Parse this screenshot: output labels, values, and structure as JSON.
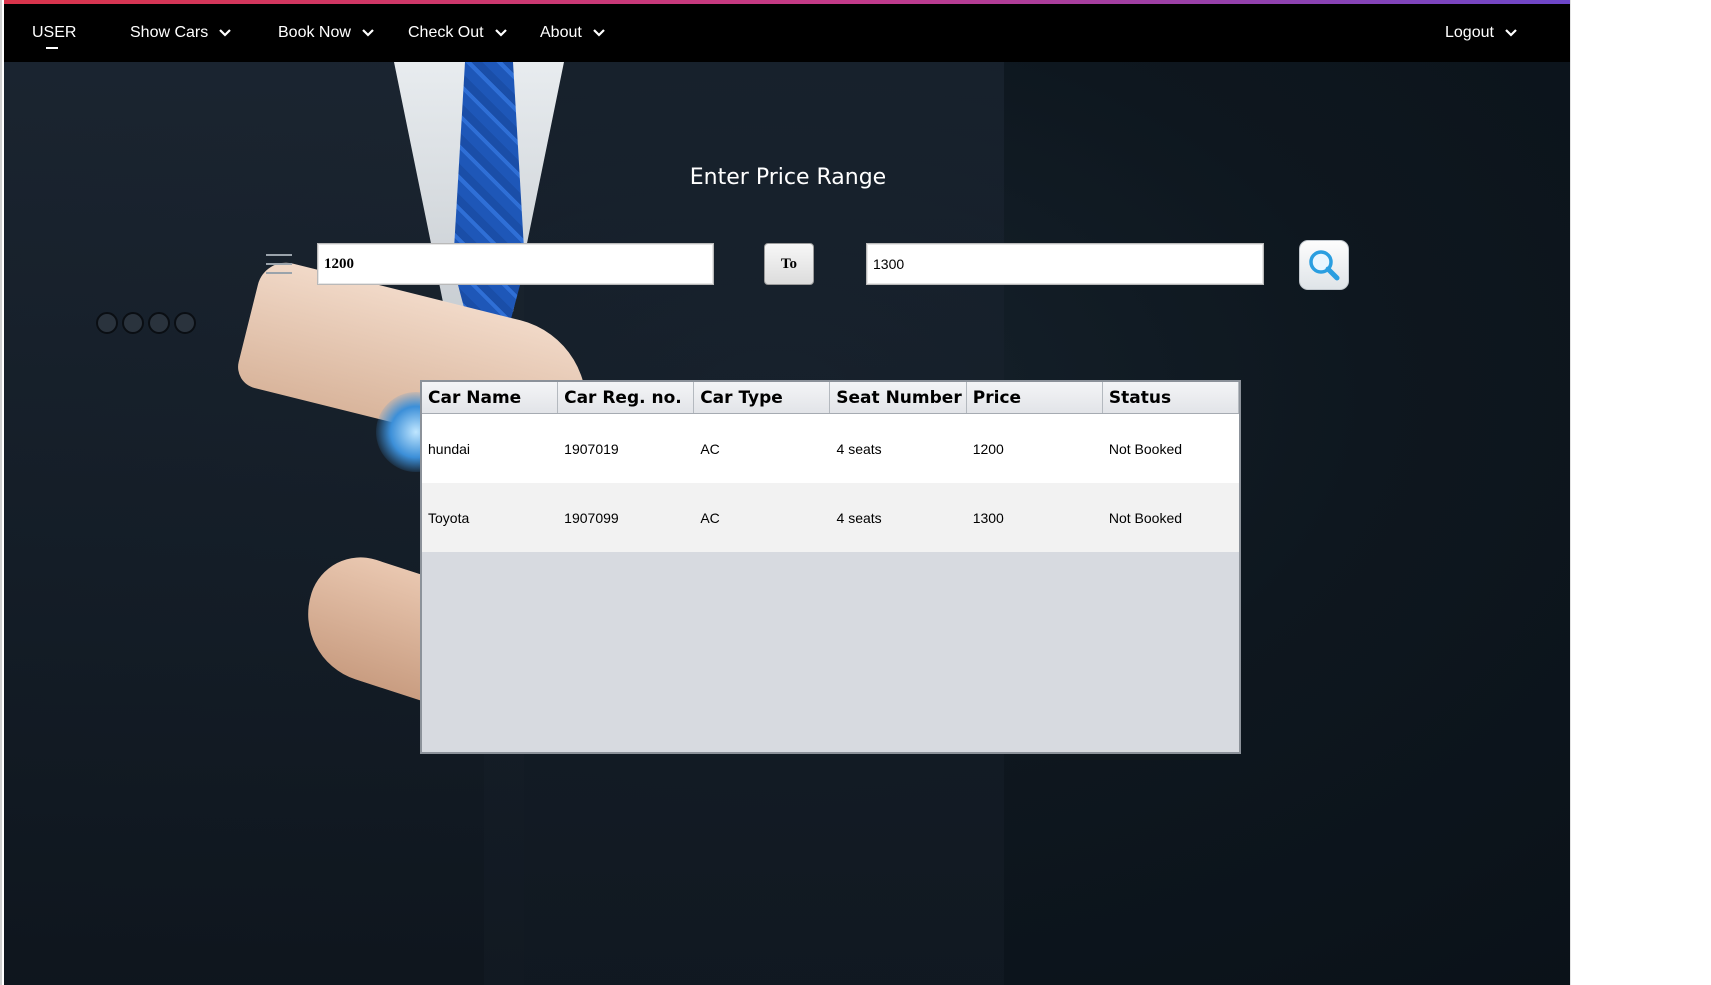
{
  "nav": {
    "user": "USER",
    "items": [
      {
        "label": "Show Cars"
      },
      {
        "label": "Book Now"
      },
      {
        "label": "Check Out"
      },
      {
        "label": "About"
      }
    ],
    "logout": "Logout"
  },
  "search": {
    "heading": "Enter Price Range",
    "from_value": "1200",
    "to_label": "To",
    "to_value": "1300"
  },
  "table": {
    "columns": [
      "Car Name",
      "Car Reg. no.",
      "Car Type",
      "Seat Number",
      "Price",
      "Status"
    ],
    "rows": [
      [
        "hundai",
        "1907019",
        "AC",
        "4 seats",
        "1200",
        "Not Booked"
      ],
      [
        "Toyota",
        "1907099",
        "AC",
        "4 seats",
        "1300",
        "Not Booked"
      ]
    ]
  },
  "icons": {
    "menu": "hamburger-icon",
    "search": "magnifier-icon",
    "chevron": "chevron-down-icon"
  },
  "colors": {
    "navbar": "#000000",
    "accent_start": "#d9344a",
    "accent_end": "#5b49d6",
    "search_icon": "#2a9ee0"
  }
}
